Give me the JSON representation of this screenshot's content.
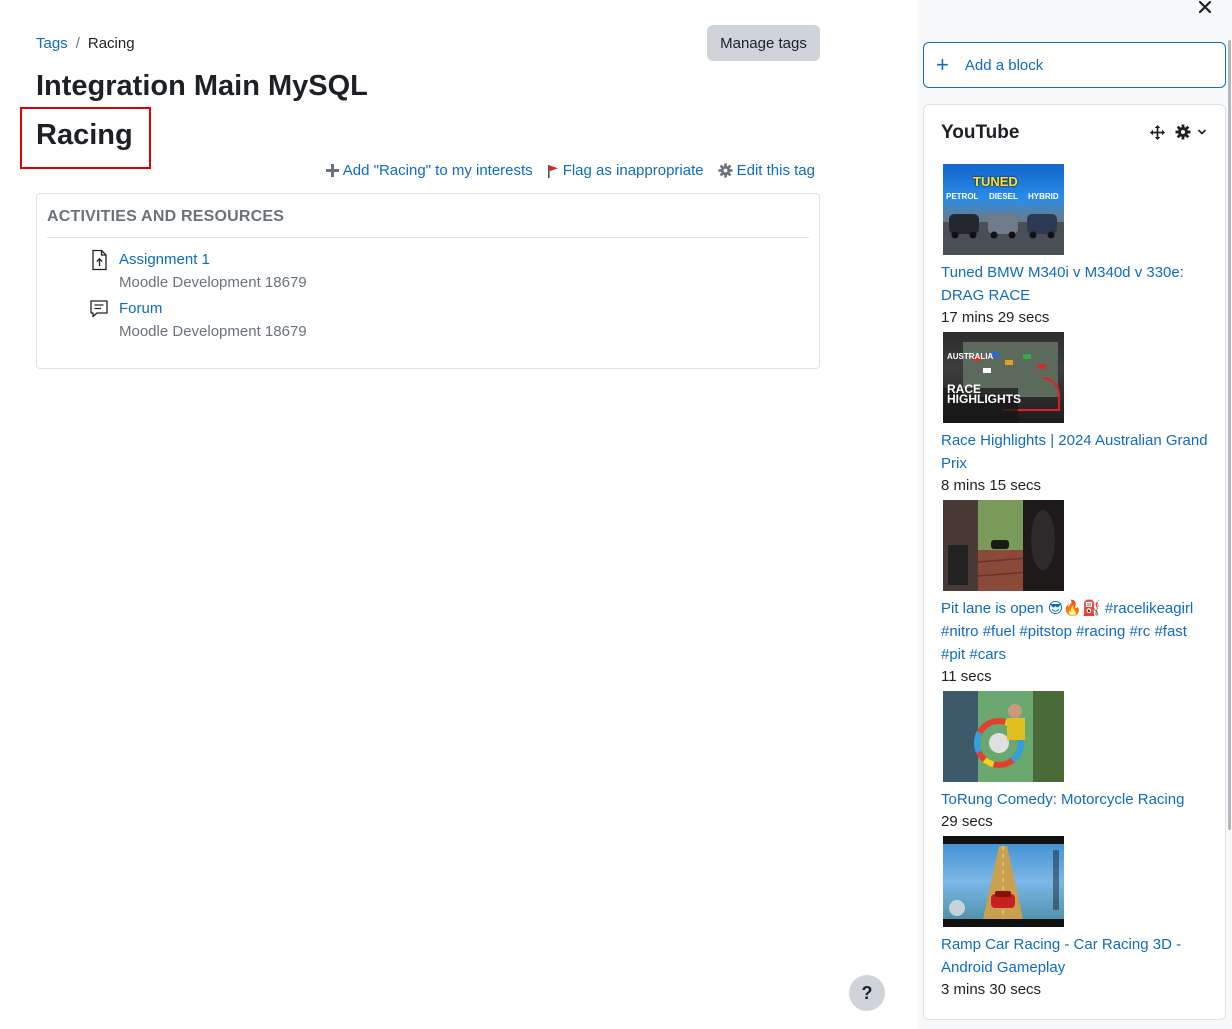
{
  "breadcrumb": {
    "parent": "Tags",
    "separator": "/",
    "current": "Racing"
  },
  "header": {
    "manage_tags_label": "Manage tags",
    "site_title": "Integration Main MySQL",
    "tag_title": "Racing"
  },
  "tag_actions": {
    "add_interest": "Add \"Racing\" to my interests",
    "flag": "Flag as inappropriate",
    "edit": "Edit this tag"
  },
  "activities": {
    "heading": "ACTIVITIES AND RESOURCES",
    "items": [
      {
        "name": "Assignment 1",
        "course": "Moodle Development 18679",
        "icon": "assignment-icon"
      },
      {
        "name": "Forum",
        "course": "Moodle Development 18679",
        "icon": "forum-icon"
      }
    ]
  },
  "help": {
    "label": "?"
  },
  "drawer": {
    "add_block_label": "Add a block",
    "youtube": {
      "title": "YouTube",
      "videos": [
        {
          "title": "Tuned BMW M340i v M340d v 330e: DRAG RACE",
          "duration": "17 mins 29 secs",
          "thumb_text": [
            "TUNED",
            "PETROL",
            "DIESEL",
            "HYBRID"
          ]
        },
        {
          "title": "Race Highlights | 2024 Australian Grand Prix",
          "duration": "8 mins 15 secs",
          "thumb_text": [
            "AUSTRALIA",
            "RACE",
            "HIGHLIGHTS"
          ]
        },
        {
          "title": "Pit lane is open 😎🔥⛽ #racelikeagirl #nitro #fuel #pitstop #racing #rc #fast #pit #cars",
          "duration": "11 secs"
        },
        {
          "title": "ToRung Comedy: Motorcycle Racing",
          "duration": "29 secs"
        },
        {
          "title": "Ramp Car Racing - Car Racing 3D - Android Gameplay",
          "duration": "3 mins 30 secs"
        }
      ]
    }
  },
  "colors": {
    "link": "#0f6cbf",
    "highlight_border": "#e00000",
    "button_bg": "#ced4da"
  }
}
